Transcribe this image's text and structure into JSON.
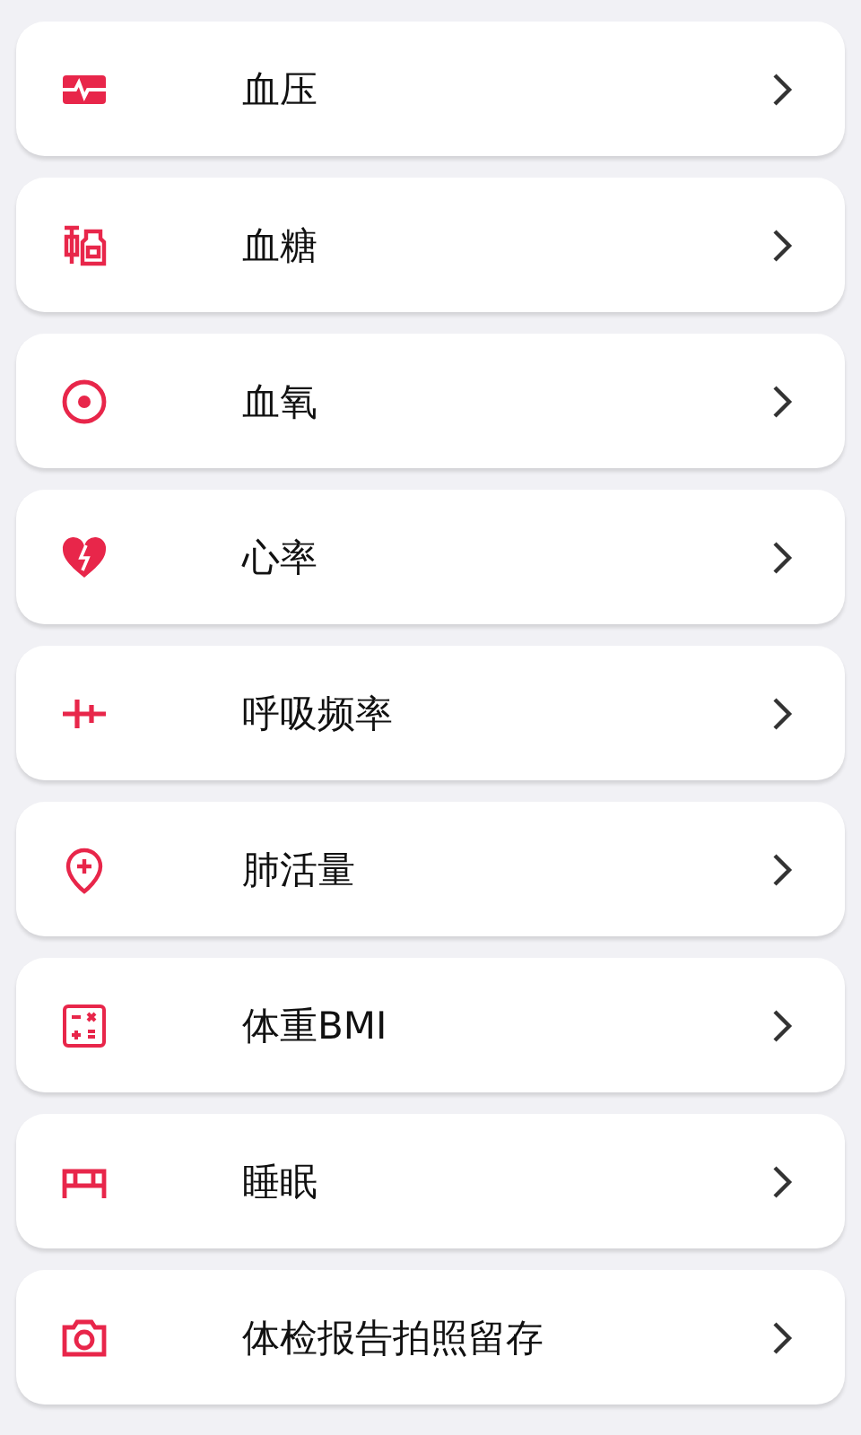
{
  "items": [
    {
      "label": "血压"
    },
    {
      "label": "血糖"
    },
    {
      "label": "血氧"
    },
    {
      "label": "心率"
    },
    {
      "label": "呼吸频率"
    },
    {
      "label": "肺活量"
    },
    {
      "label": "体重BMI"
    },
    {
      "label": "睡眠"
    },
    {
      "label": "体检报告拍照留存"
    }
  ]
}
